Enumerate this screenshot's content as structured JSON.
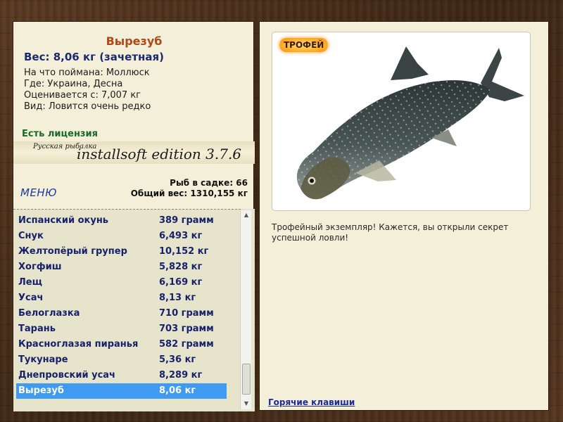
{
  "fish": {
    "name": "Вырезуб",
    "weight": "Вес: 8,06 кг (зачетная)",
    "caught_on": "На что поймана: Моллюск",
    "where": "Где: Украина, Десна",
    "rated_from": "Оценивается с: 7,007 кг",
    "kind": "Вид: Ловится очень редко"
  },
  "license": "Есть лицензия",
  "edition": {
    "small": "Русская рыбалка",
    "main": "installsoft edition 3.7.6"
  },
  "menu_label": "МЕНЮ",
  "stats": {
    "fish_in_keepnet": "Рыб в садке: 66",
    "total_weight": "Общий вес: 1310,155 кг"
  },
  "catch_list": [
    {
      "name": "Испанский окунь",
      "weight": "389 грамм"
    },
    {
      "name": "Снук",
      "weight": "6,493 кг"
    },
    {
      "name": "Желтопёрый групер",
      "weight": "10,152 кг"
    },
    {
      "name": "Хогфиш",
      "weight": "5,828 кг"
    },
    {
      "name": "Лещ",
      "weight": "6,169 кг"
    },
    {
      "name": "Усач",
      "weight": "8,13 кг"
    },
    {
      "name": "Белоглазка",
      "weight": "710 грамм"
    },
    {
      "name": "Тарань",
      "weight": "703 грамм"
    },
    {
      "name": "Красноглазая пиранья",
      "weight": "582 грамм"
    },
    {
      "name": "Тукунаре",
      "weight": "5,36 кг"
    },
    {
      "name": "Днепровский усач",
      "weight": "8,289 кг"
    },
    {
      "name": "Вырезуб",
      "weight": "8,06 кг"
    }
  ],
  "selected_index": 11,
  "trophy_badge": "ТРОФЕЙ",
  "description": "Трофейный экземпляр! Кажется, вы открыли секрет успешной ловли!",
  "hotkeys_link": "Горячие клавиши",
  "colors": {
    "accent_title": "#b04818",
    "list_text": "#17216e",
    "selection": "#3f9af0",
    "license": "#1a6a2a"
  }
}
